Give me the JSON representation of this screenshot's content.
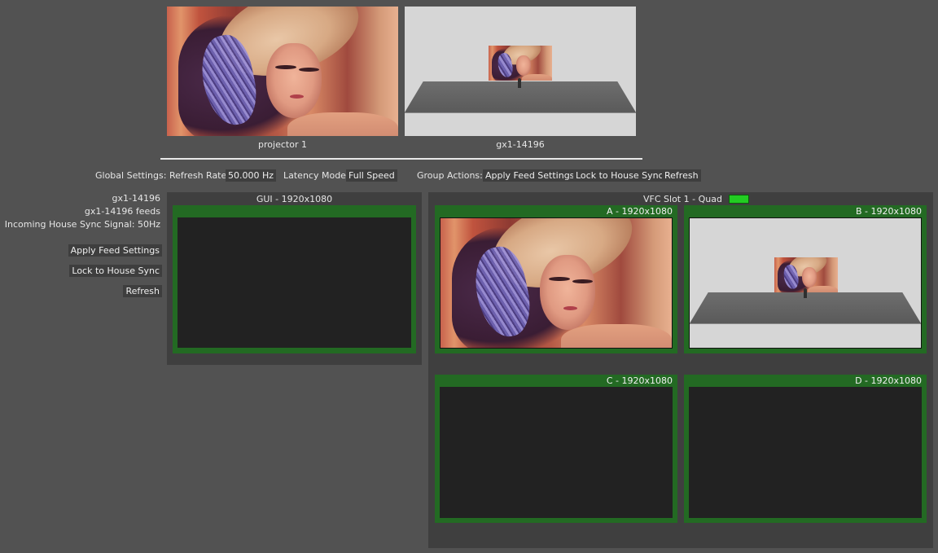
{
  "previews": [
    {
      "label": "projector 1",
      "kind": "portrait"
    },
    {
      "label": "gx1-14196",
      "kind": "scene"
    }
  ],
  "global_settings": {
    "label": "Global Settings:",
    "refresh_rate_label": "Refresh Rate",
    "refresh_rate_value": "50.000 Hz",
    "latency_mode_label": "Latency Mode",
    "latency_mode_value": "Full Speed"
  },
  "group_actions": {
    "label": "Group Actions:",
    "apply_feed_settings": "Apply Feed Settings",
    "lock_to_house_sync": "Lock to House Sync",
    "refresh": "Refresh"
  },
  "device": {
    "name": "gx1-14196",
    "feeds": "gx1-14196 feeds",
    "house_sync": "Incoming House Sync Signal: 50Hz",
    "apply_feed_settings": "Apply Feed Settings",
    "lock_to_house_sync": "Lock to House Sync",
    "refresh": "Refresh"
  },
  "gui_panel": {
    "title": "GUI - 1920x1080"
  },
  "vfc_panel": {
    "title": "VFC Slot 1 - Quad",
    "status_color": "#22cc22",
    "slots": [
      {
        "label": "A - 1920x1080",
        "content": "portrait"
      },
      {
        "label": "B - 1920x1080",
        "content": "scene"
      },
      {
        "label": "C - 1920x1080",
        "content": "empty"
      },
      {
        "label": "D - 1920x1080",
        "content": "empty"
      }
    ]
  },
  "colors": {
    "background": "#525252",
    "panel": "#3f3f3f",
    "slot_border": "#236a23",
    "slot_empty": "#222222"
  }
}
